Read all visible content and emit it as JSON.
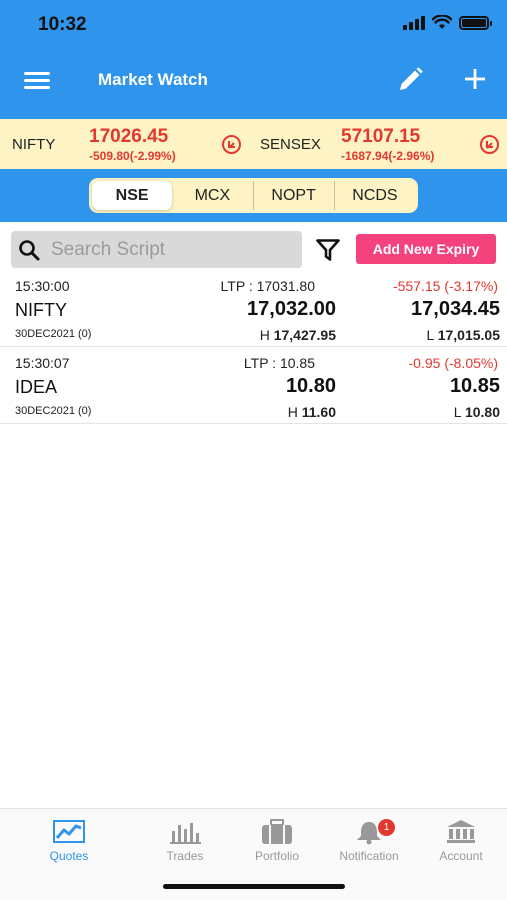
{
  "status_bar": {
    "time": "10:32"
  },
  "header": {
    "title": "Market Watch"
  },
  "ticker": [
    {
      "name": "NIFTY",
      "price": "17026.45",
      "change": "-509.80(-2.99%)"
    },
    {
      "name": "SENSEX",
      "price": "57107.15",
      "change": "-1687.94(-2.96%)"
    }
  ],
  "segments": [
    "NSE",
    "MCX",
    "NOPT",
    "NCDS"
  ],
  "active_segment": "NSE",
  "search": {
    "placeholder": "Search Script",
    "value": ""
  },
  "add_expiry_label": "Add New Expiry",
  "quotes": [
    {
      "time": "15:30:00",
      "ltp": "LTP : 17031.80",
      "change": "-557.15 (-3.17%)",
      "symbol": "NIFTY",
      "bid": "17,032.00",
      "ask": "17,034.45",
      "expiry": "30DEC2021 (0)",
      "high_label": "H",
      "high": "17,427.95",
      "low_label": "L",
      "low": "17,015.05"
    },
    {
      "time": "15:30:07",
      "ltp": "LTP : 10.85",
      "change": "-0.95 (-8.05%)",
      "symbol": "IDEA",
      "bid": "10.80",
      "ask": "10.85",
      "expiry": "30DEC2021 (0)",
      "high_label": "H",
      "high": "11.60",
      "low_label": "L",
      "low": "10.80"
    }
  ],
  "tabs": [
    {
      "label": "Quotes",
      "icon": "chart-line-icon"
    },
    {
      "label": "Trades",
      "icon": "bar-chart-icon"
    },
    {
      "label": "Portfolio",
      "icon": "briefcase-icon"
    },
    {
      "label": "Notification",
      "icon": "bell-icon",
      "badge": "1"
    },
    {
      "label": "Account",
      "icon": "bank-icon"
    }
  ],
  "colors": {
    "primary": "#2f94ec",
    "negative": "#e2382f",
    "ticker_bg": "#fdf3c4",
    "accent_button": "#f4437c"
  }
}
